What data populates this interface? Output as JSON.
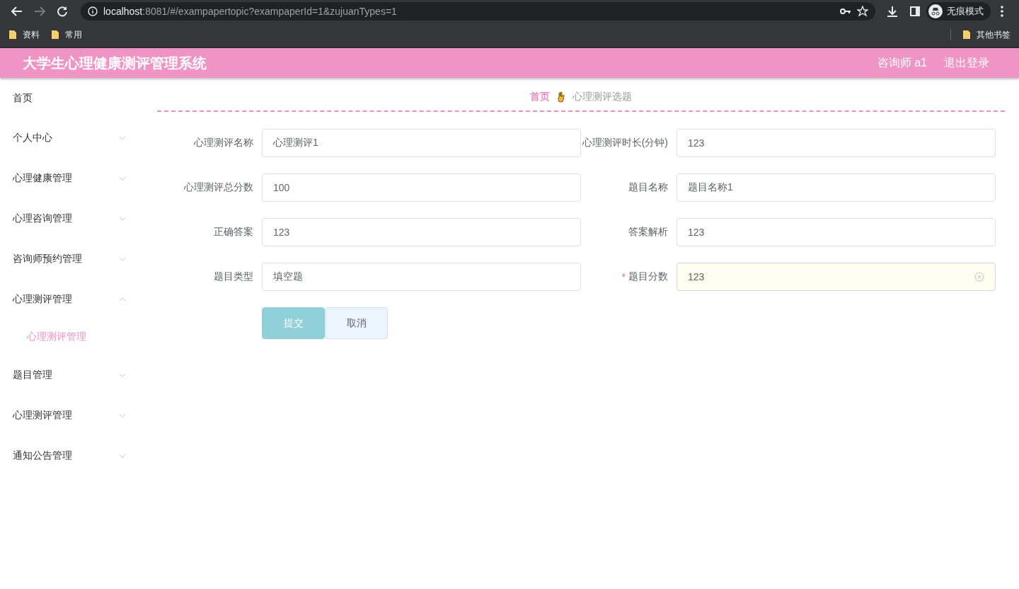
{
  "browser": {
    "url_host": "localhost",
    "url_rest": ":8081/#/exampapertopic?exampaperId=1&zujuanTypes=1",
    "profile": "无痕模式",
    "bookmarks": [
      "资料",
      "常用"
    ],
    "other_bookmarks": "其他书签"
  },
  "header": {
    "title": "大学生心理健康测评管理系统",
    "user": "咨询师 a1",
    "logout": "退出登录"
  },
  "sidebar": {
    "items": [
      {
        "label": "首页",
        "kind": "link"
      },
      {
        "label": "个人中心",
        "kind": "submenu",
        "expanded": false
      },
      {
        "label": "心理健康管理",
        "kind": "submenu",
        "expanded": false
      },
      {
        "label": "心理咨询管理",
        "kind": "submenu",
        "expanded": false
      },
      {
        "label": "咨询师预约管理",
        "kind": "submenu",
        "expanded": false
      },
      {
        "label": "心理测评管理",
        "kind": "submenu",
        "expanded": true,
        "children": [
          {
            "label": "心理测评管理",
            "selected": true
          }
        ]
      },
      {
        "label": "题目管理",
        "kind": "submenu",
        "expanded": false
      },
      {
        "label": "心理测评管理",
        "kind": "submenu",
        "expanded": false
      },
      {
        "label": "通知公告管理",
        "kind": "submenu",
        "expanded": false
      }
    ]
  },
  "breadcrumb": [
    {
      "label": "首页",
      "kind": "link"
    },
    {
      "label": "心理测评选题",
      "kind": "current"
    }
  ],
  "form": {
    "fields": [
      {
        "label": "心理测评名称",
        "value": "心理测评1",
        "kind": "text"
      },
      {
        "label": "心理测评时长(分钟)",
        "value": "123",
        "kind": "text"
      },
      {
        "label": "心理测评总分数",
        "value": "100",
        "kind": "text"
      },
      {
        "label": "题目名称",
        "value": "题目名称1",
        "kind": "text"
      },
      {
        "label": "正确答案",
        "value": "123",
        "kind": "text"
      },
      {
        "label": "答案解析",
        "value": "123",
        "kind": "text"
      },
      {
        "label": "题目类型",
        "value": "填空题",
        "kind": "text"
      },
      {
        "label": "题目分数",
        "required_mark": "*",
        "value": "123",
        "kind": "clearable"
      }
    ],
    "buttons": [
      {
        "label": "提交",
        "kind": "primary"
      },
      {
        "label": "取消",
        "kind": "default"
      }
    ]
  }
}
